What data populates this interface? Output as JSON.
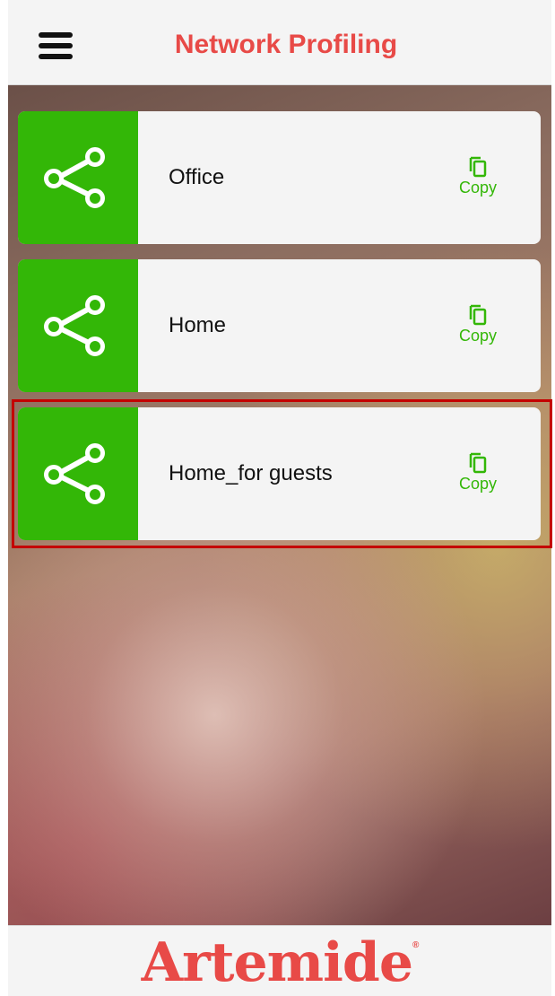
{
  "header": {
    "title": "Network Profiling",
    "menu_icon": "hamburger-menu-icon"
  },
  "profiles": [
    {
      "name": "Office",
      "icon": "share-network-icon",
      "copy_label": "Copy",
      "highlighted": false
    },
    {
      "name": "Home",
      "icon": "share-network-icon",
      "copy_label": "Copy",
      "highlighted": false
    },
    {
      "name": "Home_for guests",
      "icon": "share-network-icon",
      "copy_label": "Copy",
      "highlighted": true
    }
  ],
  "footer": {
    "brand": "Artemide",
    "registered_mark": "®"
  },
  "colors": {
    "accent_green": "#33b707",
    "brand_red": "#e84a47",
    "highlight_red": "#c40000"
  }
}
